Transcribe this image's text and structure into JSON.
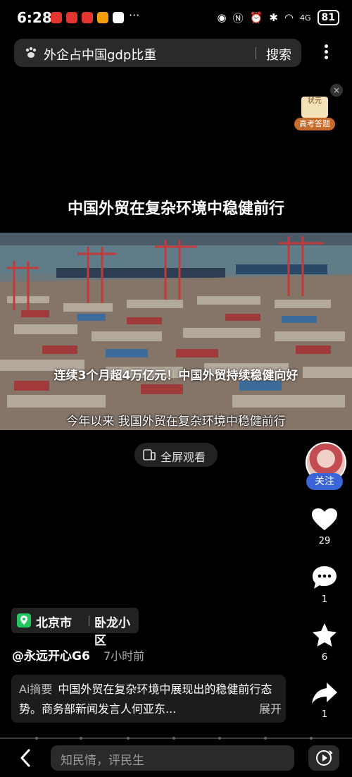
{
  "status_bar": {
    "time": "6:28",
    "more": "···",
    "signal": "4G",
    "battery": "81"
  },
  "search": {
    "query": "外企占中国gdp比重",
    "button": "搜索"
  },
  "badge": {
    "top_text": "状元",
    "bottom_text": "高考答题",
    "close": "×"
  },
  "video": {
    "header_title": "中国外贸在复杂环境中稳健前行",
    "overlay_title": "连续3个月超4万亿元！中国外贸持续稳健向好",
    "subtitle": "今年以来 我国外贸在复杂环境中稳健前行",
    "fullscreen_label": "全屏观看"
  },
  "rail": {
    "follow": "关注",
    "likes": "29",
    "comments": "1",
    "favorites": "6",
    "shares": "1"
  },
  "location": {
    "city": "北京市",
    "area": "卧龙小区"
  },
  "author": {
    "name": "@永远开心G6",
    "time": "7小时前"
  },
  "summary": {
    "label": "Ai摘要",
    "text": "中国外贸在复杂环境中展现出的稳健前行态势。商务部新闻发言人何亚东...",
    "expand": "展开"
  },
  "comment_box": {
    "placeholder": "知民情，评民生"
  },
  "colors": {
    "accent": "#3a64d8",
    "location_pin": "#22c55e"
  }
}
